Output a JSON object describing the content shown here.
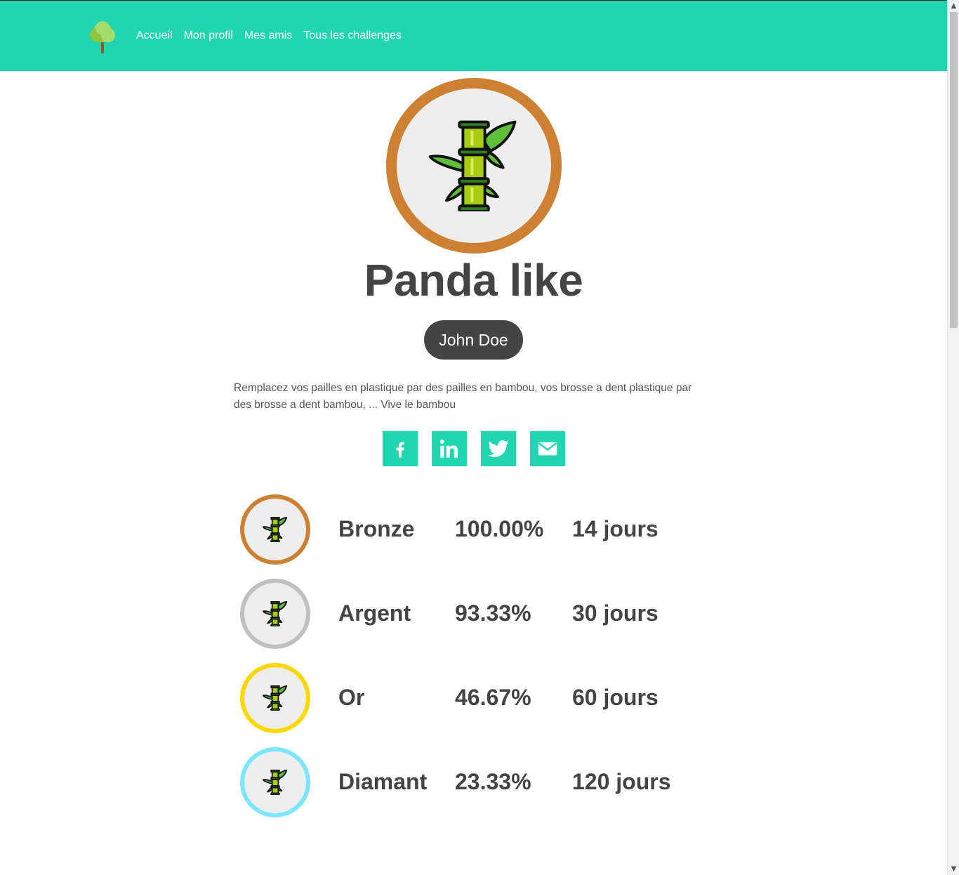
{
  "nav": {
    "logo": "tree-logo",
    "links": [
      "Accueil",
      "Mon profil",
      "Mes amis",
      "Tous les challenges"
    ]
  },
  "challenge": {
    "title": "Panda like",
    "author": "John Doe",
    "description": "Remplacez vos pailles en plastique par des pailles en bambou, vos brosse a dent plastique par des brosse a dent bambou, ... Vive le bambou",
    "icon": "bamboo-icon"
  },
  "share": [
    "facebook-icon",
    "linkedin-icon",
    "twitter-icon",
    "email-icon"
  ],
  "levels": [
    {
      "name": "Bronze",
      "percent": "100.00%",
      "duration": "14 jours",
      "color": "#cd7f32"
    },
    {
      "name": "Argent",
      "percent": "93.33%",
      "duration": "30 jours",
      "color": "#c0c0c0"
    },
    {
      "name": "Or",
      "percent": "46.67%",
      "duration": "60 jours",
      "color": "#ffd700"
    },
    {
      "name": "Diamant",
      "percent": "23.33%",
      "duration": "120 jours",
      "color": "#7be6ff"
    }
  ],
  "colors": {
    "accent": "#1fd6b1",
    "text": "#444444"
  }
}
